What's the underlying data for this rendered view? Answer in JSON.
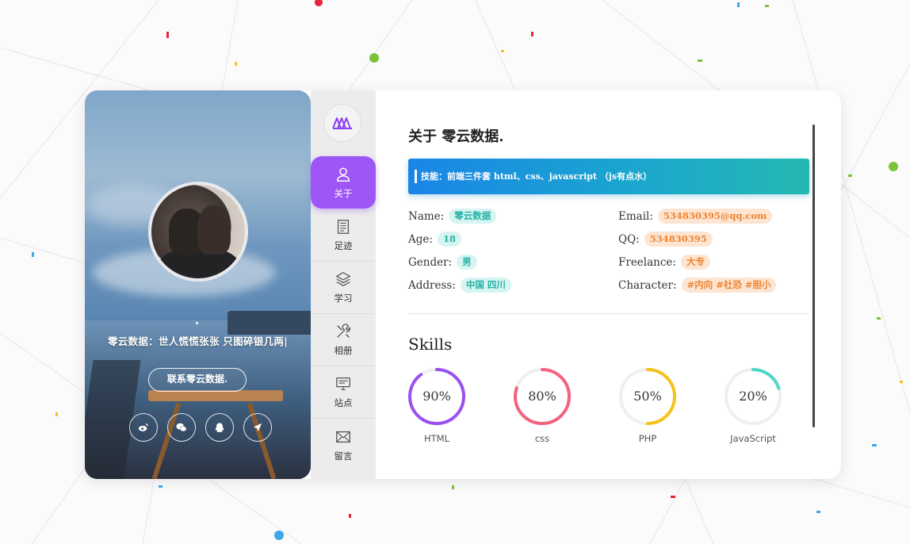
{
  "profile": {
    "motto": "零云数据：世人慌慌张张 只图碎银几两|",
    "contact_button": "联系零云数据.",
    "social_icons": [
      "weibo-icon",
      "wechat-icon",
      "qq-icon",
      "send-icon"
    ]
  },
  "nav": {
    "logo_icon": "logo-icon",
    "items": [
      {
        "label": "关于",
        "icon": "user-icon",
        "active": true
      },
      {
        "label": "足迹",
        "icon": "document-icon",
        "active": false
      },
      {
        "label": "学习",
        "icon": "layers-icon",
        "active": false
      },
      {
        "label": "相册",
        "icon": "tools-icon",
        "active": false
      },
      {
        "label": "站点",
        "icon": "monitor-icon",
        "active": false
      },
      {
        "label": "留言",
        "icon": "mail-icon",
        "active": false
      }
    ],
    "accent": "#9e57f6"
  },
  "about": {
    "title": "关于 零云数据.",
    "skill_banner": "技能：前端三件套 html、css、javascript （js有点水）",
    "fields": [
      {
        "label": "Name:",
        "value": "零云数据",
        "color": "teal"
      },
      {
        "label": "Email:",
        "value": "534830395@qq.com",
        "color": "orange"
      },
      {
        "label": "Age:",
        "value": "18",
        "color": "teal"
      },
      {
        "label": "QQ:",
        "value": "534830395",
        "color": "orange"
      },
      {
        "label": "Gender:",
        "value": "男",
        "color": "teal"
      },
      {
        "label": "Freelance:",
        "value": "大专",
        "color": "orange"
      },
      {
        "label": "Address:",
        "value": "中国 四川",
        "color": "teal"
      },
      {
        "label": "Character:",
        "value": "#内向 #社恐 #胆小",
        "color": "orange"
      }
    ]
  },
  "skills": {
    "title": "Skills",
    "items": [
      {
        "name": "HTML",
        "percent": 90,
        "percent_label": "90%",
        "color": "#9b50f0"
      },
      {
        "name": "css",
        "percent": 80,
        "percent_label": "80%",
        "color": "#f2637e"
      },
      {
        "name": "PHP",
        "percent": 50,
        "percent_label": "50%",
        "color": "#f6c21c"
      },
      {
        "name": "JavaScript",
        "percent": 20,
        "percent_label": "20%",
        "color": "#4fd6c4"
      }
    ]
  }
}
